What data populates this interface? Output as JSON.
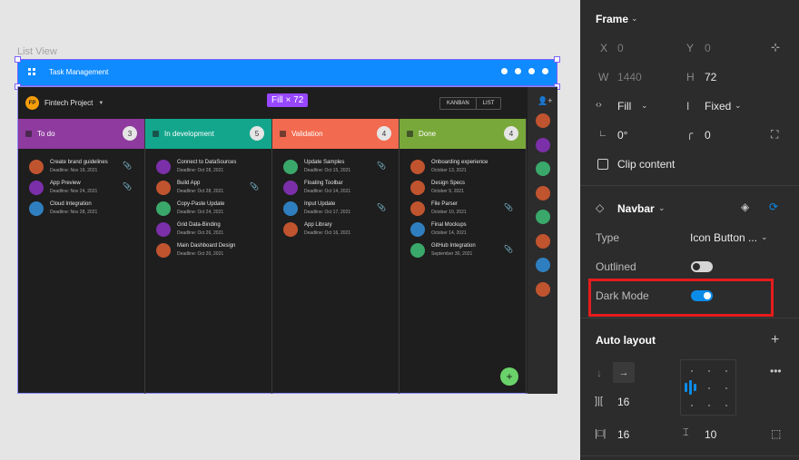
{
  "canvas": {
    "frame_label": "List View",
    "navbar": {
      "title": "Task Management",
      "bg": "#0f8bff"
    },
    "project": {
      "initials": "FP",
      "name": "Fintech Project"
    },
    "fill_badge": "Fill × 72",
    "view_buttons": [
      "KANBAN",
      "LIST"
    ],
    "columns": [
      {
        "title": "To do",
        "count": "3",
        "color": "#8e3a9e",
        "tasks": [
          {
            "title": "Create brand guidelines",
            "deadline": "Deadline: Nov 19, 2021",
            "clip": true,
            "avatar": "#c0542f"
          },
          {
            "title": "App Preview",
            "deadline": "Deadline: Nov 24, 2021",
            "clip": true,
            "avatar": "#7b2fa8"
          },
          {
            "title": "Cloud Integration",
            "deadline": "Deadline: Nov 28, 2021",
            "clip": false,
            "avatar": "#2f7fc0"
          }
        ]
      },
      {
        "title": "In development",
        "count": "5",
        "color": "#13a68c",
        "tasks": [
          {
            "title": "Connect to DataSources",
            "deadline": "Deadline: Oct 28, 2021",
            "clip": false,
            "avatar": "#7b2fa8"
          },
          {
            "title": "Build App",
            "deadline": "Deadline: Oct 28, 2021",
            "clip": true,
            "avatar": "#c0542f"
          },
          {
            "title": "Copy-Paste Update",
            "deadline": "Deadline: Oct 24, 2021",
            "clip": false,
            "avatar": "#3aa86a"
          },
          {
            "title": "Grid Data-Binding",
            "deadline": "Deadline: Oct 26, 2021",
            "clip": false,
            "avatar": "#7b2fa8"
          },
          {
            "title": "Main Dashboard Design",
            "deadline": "Deadline: Oct 20, 2021",
            "clip": false,
            "avatar": "#c0542f"
          }
        ]
      },
      {
        "title": "Validation",
        "count": "4",
        "color": "#f26a4f",
        "tasks": [
          {
            "title": "Update Samples",
            "deadline": "Deadline: Oct 15, 2021",
            "clip": true,
            "avatar": "#3aa86a"
          },
          {
            "title": "Floating Toolbar",
            "deadline": "Deadline: Oct 14, 2021",
            "clip": false,
            "avatar": "#7b2fa8"
          },
          {
            "title": "Input Update",
            "deadline": "Deadline: Oct 17, 2021",
            "clip": true,
            "avatar": "#2f7fc0"
          },
          {
            "title": "App Library",
            "deadline": "Deadline: Oct 16, 2021",
            "clip": false,
            "avatar": "#c0542f"
          }
        ]
      },
      {
        "title": "Done",
        "count": "4",
        "color": "#79a83a",
        "tasks": [
          {
            "title": "Onboarding experience",
            "deadline": "October 13, 2021",
            "clip": false,
            "avatar": "#c0542f"
          },
          {
            "title": "Design Specs",
            "deadline": "October 9, 2021",
            "clip": false,
            "avatar": "#c0542f"
          },
          {
            "title": "File Parser",
            "deadline": "October 10, 2021",
            "clip": true,
            "avatar": "#c0542f"
          },
          {
            "title": "Final Mockups",
            "deadline": "October 14, 2021",
            "clip": false,
            "avatar": "#2f7fc0"
          },
          {
            "title": "GitHub Integration",
            "deadline": "September 30, 2021",
            "clip": true,
            "avatar": "#3aa86a"
          }
        ]
      }
    ],
    "side_avatars": [
      "#c0542f",
      "#7b2fa8",
      "#3aa86a",
      "#c0542f",
      "#3aa86a",
      "#c0542f",
      "#2f7fc0",
      "#c0542f"
    ],
    "fab": "+"
  },
  "panel": {
    "frame": {
      "title": "Frame",
      "x_label": "X",
      "x_value": "0",
      "y_label": "Y",
      "y_value": "0",
      "w_label": "W",
      "w_value": "1440",
      "h_label": "H",
      "h_value": "72",
      "width_mode": "Fill",
      "height_mode": "Fixed",
      "rotation": "0°",
      "radius": "0",
      "clip_label": "Clip content"
    },
    "component": {
      "name": "Navbar",
      "type_label": "Type",
      "type_value": "Icon Button ...",
      "outlined_label": "Outlined",
      "outlined_on": false,
      "dark_label": "Dark Mode",
      "dark_on": true
    },
    "auto_layout": {
      "title": "Auto layout",
      "gap_between": "16",
      "padding_horizontal": "16",
      "padding_vertical": "10"
    },
    "accent": "#0c8ce9",
    "highlight": "#e61c1c"
  }
}
